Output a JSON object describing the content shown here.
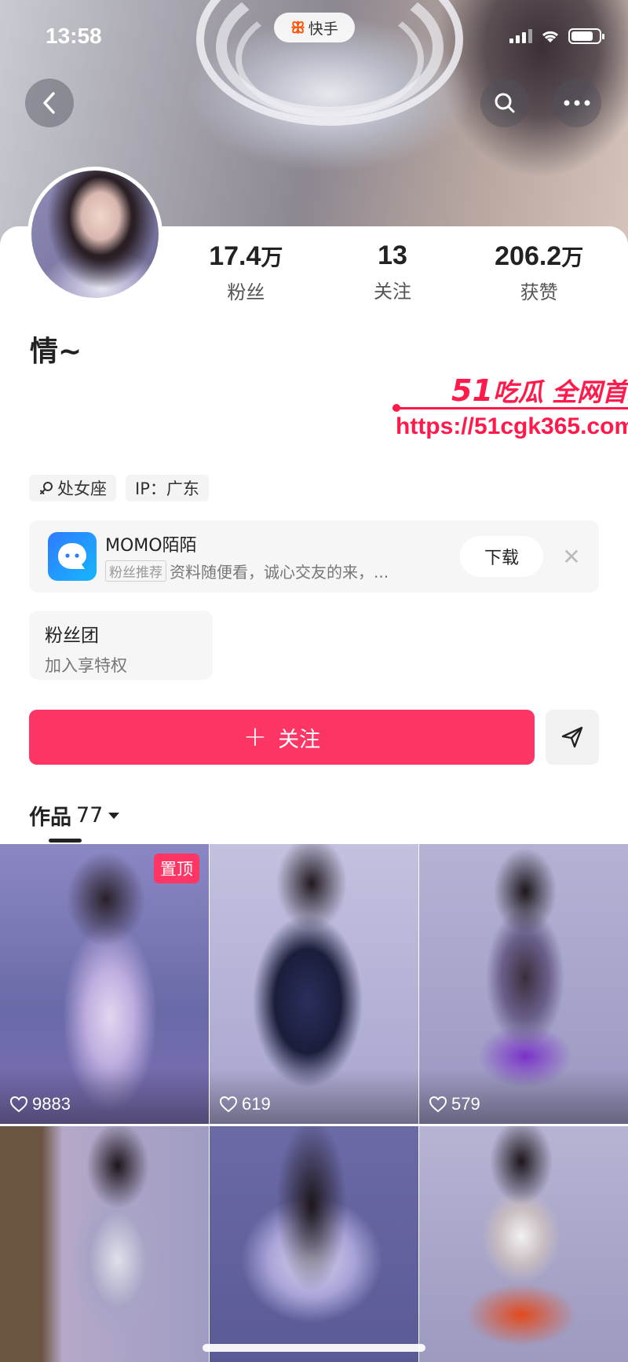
{
  "status_bar": {
    "time": "13:58",
    "app_pill": "快手",
    "icons": [
      "signal-icon",
      "wifi-icon",
      "battery-icon"
    ]
  },
  "nav": {
    "back_icon": "chevron-left-icon",
    "search_icon": "search-icon",
    "more_icon": "more-dots-icon"
  },
  "profile": {
    "name": "情~",
    "stats": [
      {
        "value": "17.4",
        "unit": "万",
        "label": "粉丝"
      },
      {
        "value": "13",
        "unit": "",
        "label": "关注"
      },
      {
        "value": "206.2",
        "unit": "万",
        "label": "获赞"
      }
    ],
    "tags": [
      {
        "icon": "female-symbol-icon",
        "label": "处女座"
      },
      {
        "icon": "",
        "label": "IP：广东"
      }
    ]
  },
  "watermark": {
    "num": "51",
    "text": "吃瓜 全网首发",
    "url": "https://51cgk365.com"
  },
  "promo": {
    "title": "MOMO陌陌",
    "badge": "粉丝推荐",
    "description": "资料随便看，诚心交友的来，...",
    "download_label": "下载",
    "close_label": "✕",
    "accent": "#2f7bff"
  },
  "fan_club": {
    "title": "粉丝团",
    "subtitle": "加入享特权"
  },
  "actions": {
    "follow_label": "关注",
    "follow_color": "#fe3666"
  },
  "works": {
    "label": "作品",
    "count": "77",
    "items": [
      {
        "likes": "9883",
        "pinned": "置顶"
      },
      {
        "likes": "619",
        "pinned": ""
      },
      {
        "likes": "579",
        "pinned": ""
      },
      {
        "likes": "",
        "pinned": ""
      },
      {
        "likes": "",
        "pinned": ""
      },
      {
        "likes": "",
        "pinned": ""
      }
    ]
  }
}
